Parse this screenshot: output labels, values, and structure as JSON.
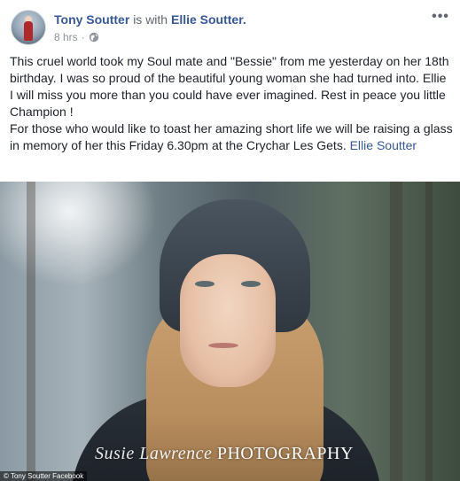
{
  "post": {
    "author": "Tony Soutter",
    "with_prefix": "is with",
    "tagged": "Ellie Soutter.",
    "time": "8 hrs",
    "separator": "·",
    "body_line1": "This cruel world took my Soul mate and \"Bessie\" from me yesterday on her 18th birthday. I was so proud of the beautiful young woman she had turned into. Ellie I will miss you more than you could have ever imagined. Rest in peace you little Champion !",
    "body_line2": "For those who would like to toast her amazing short life we will be raising a glass in memory of her this Friday 6.30pm at the Crychar Les Gets.",
    "body_tag": "Ellie Soutter",
    "more_label": "•••"
  },
  "photo": {
    "watermark_script": "Susie Lawrence",
    "watermark_caps": "PHOTOGRAPHY",
    "caption": "© Tony Soutter Facebook"
  },
  "icons": {
    "globe": "globe-icon",
    "more": "more-options-icon"
  },
  "colors": {
    "link": "#365899",
    "meta": "#90949c",
    "text": "#1d2129"
  }
}
